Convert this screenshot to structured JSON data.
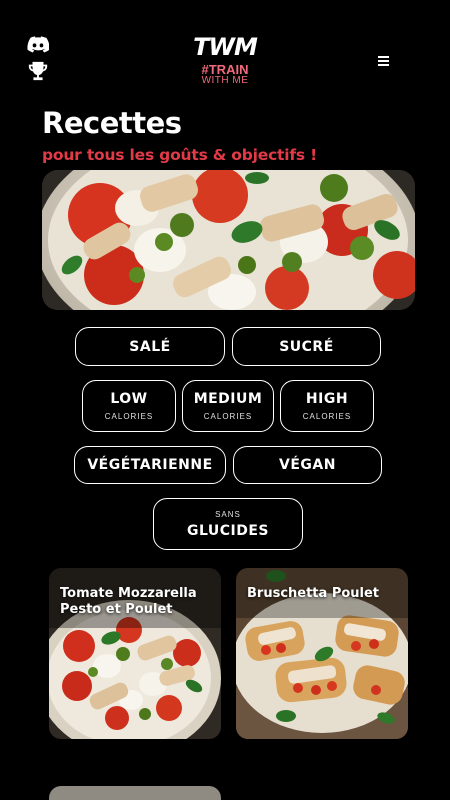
{
  "header": {
    "logo_main": "TWM",
    "logo_tag": "#TRAIN",
    "logo_sub": "WITH ME",
    "left_icons": [
      "discord-icon",
      "trophy-icon"
    ],
    "right_icon": "menu-icon"
  },
  "page": {
    "title": "Recettes",
    "subtitle": "pour tous les goûts & objectifs !"
  },
  "hero": {
    "image": "caprese-chicken-salad-photo"
  },
  "filters": {
    "sale": {
      "label": "SALÉ"
    },
    "sucre": {
      "label": "SUCRÉ"
    },
    "low": {
      "label": "LOW",
      "sub": "CALORIES"
    },
    "medium": {
      "label": "MEDIUM",
      "sub": "CALORIES"
    },
    "high": {
      "label": "HIGH",
      "sub": "CALORIES"
    },
    "vegetarienne": {
      "label": "VÉGÉTARIENNE"
    },
    "vegan": {
      "label": "VÉGAN"
    },
    "glucides": {
      "label": "GLUCIDES",
      "pre": "SANS"
    }
  },
  "recipes": [
    {
      "title": "Tomate Mozzarella Pesto et Poulet"
    },
    {
      "title": "Bruschetta Poulet"
    }
  ],
  "colors": {
    "accent": "#e23a46",
    "logo_pink": "#f06a7d",
    "background": "#000000"
  }
}
